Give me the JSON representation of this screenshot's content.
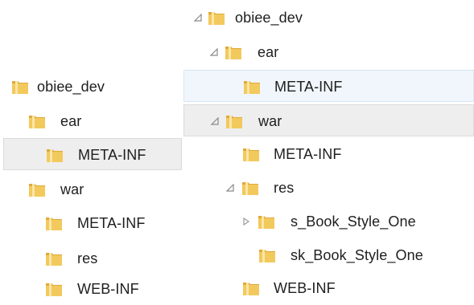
{
  "left_tree": {
    "items": [
      {
        "label": "obiee_dev"
      },
      {
        "label": "ear"
      },
      {
        "label": "META-INF"
      },
      {
        "label": "war"
      },
      {
        "label": "META-INF"
      },
      {
        "label": "res"
      },
      {
        "label": "WEB-INF"
      }
    ]
  },
  "right_tree": {
    "items": [
      {
        "label": "obiee_dev",
        "state": "expanded"
      },
      {
        "label": "ear",
        "state": "expanded"
      },
      {
        "label": "META-INF",
        "state": "none"
      },
      {
        "label": "war",
        "state": "expanded"
      },
      {
        "label": "META-INF",
        "state": "none"
      },
      {
        "label": "res",
        "state": "expanded"
      },
      {
        "label": "s_Book_Style_One",
        "state": "collapsed"
      },
      {
        "label": "sk_Book_Style_One",
        "state": "none"
      },
      {
        "label": "WEB-INF",
        "state": "none"
      }
    ]
  },
  "icons": {
    "folder": "folder-icon",
    "expanded": "expanded-arrow-icon",
    "collapsed": "collapsed-arrow-icon"
  },
  "colors": {
    "selection_gray": "#eeeeee",
    "selection_blue": "#f0f6fb",
    "folder_body": "#f2c95d",
    "folder_tab": "#e0a93a"
  }
}
